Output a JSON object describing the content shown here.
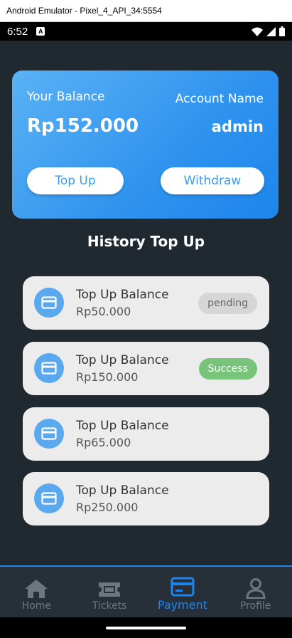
{
  "window": {
    "title": "Android Emulator - Pixel_4_API_34:5554"
  },
  "status_bar": {
    "time": "6:52",
    "notification_letter": "A"
  },
  "balance_card": {
    "balance_label": "Your Balance",
    "balance_value": "Rp152.000",
    "account_label": "Account Name",
    "account_value": "admin",
    "topup_label": "Top Up",
    "withdraw_label": "Withdraw"
  },
  "history": {
    "title": "History Top Up",
    "items": [
      {
        "title": "Top Up Balance",
        "amount": "Rp50.000",
        "status": "pending"
      },
      {
        "title": "Top Up Balance",
        "amount": "Rp150.000",
        "status": "Success"
      },
      {
        "title": "Top Up Balance",
        "amount": "Rp65.000",
        "status": ""
      },
      {
        "title": "Top Up Balance",
        "amount": "Rp250.000",
        "status": ""
      }
    ]
  },
  "bottom_nav": {
    "items": [
      {
        "label": "Home",
        "icon": "home-icon"
      },
      {
        "label": "Tickets",
        "icon": "ticket-icon"
      },
      {
        "label": "Payment",
        "icon": "payment-card-icon",
        "active": true
      },
      {
        "label": "Profile",
        "icon": "profile-icon"
      }
    ]
  },
  "colors": {
    "background": "#202830",
    "accent": "#1d86ec",
    "card_gradient_start": "#5ab2f5",
    "success": "#78c47a",
    "pending": "#d6d6d6"
  }
}
